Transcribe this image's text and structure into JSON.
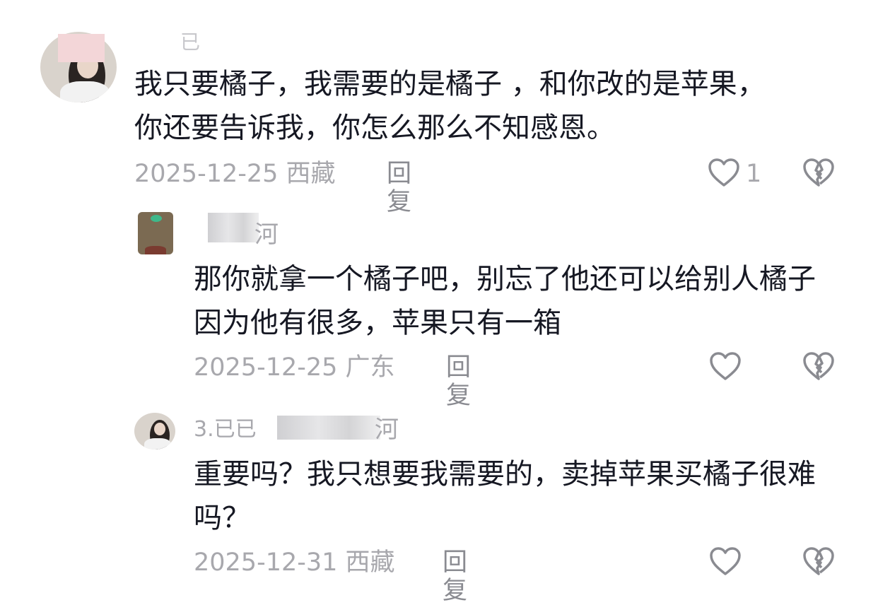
{
  "comments": [
    {
      "username": "已",
      "content": "我只要橘子，我需要的是橘子 ，和你改的是苹果，你还要告诉我，你怎么那么不知感恩。",
      "date": "2025-12-25",
      "location": "西藏",
      "reply_label": "回复",
      "like_count": "1"
    },
    {
      "username": "河",
      "content": "那你就拿一个橘子吧，别忘了他还可以给别人橘子因为他有很多，苹果只有一箱",
      "date": "2025-12-25",
      "location": "广东",
      "reply_label": "回复",
      "like_count": ""
    },
    {
      "username": "3.已已",
      "username_tail": "河",
      "content": "重要吗？我只想要我需要的，卖掉苹果买橘子很难吗？",
      "date": "2025-12-31",
      "location": "西藏",
      "reply_label": "回复",
      "like_count": ""
    }
  ]
}
